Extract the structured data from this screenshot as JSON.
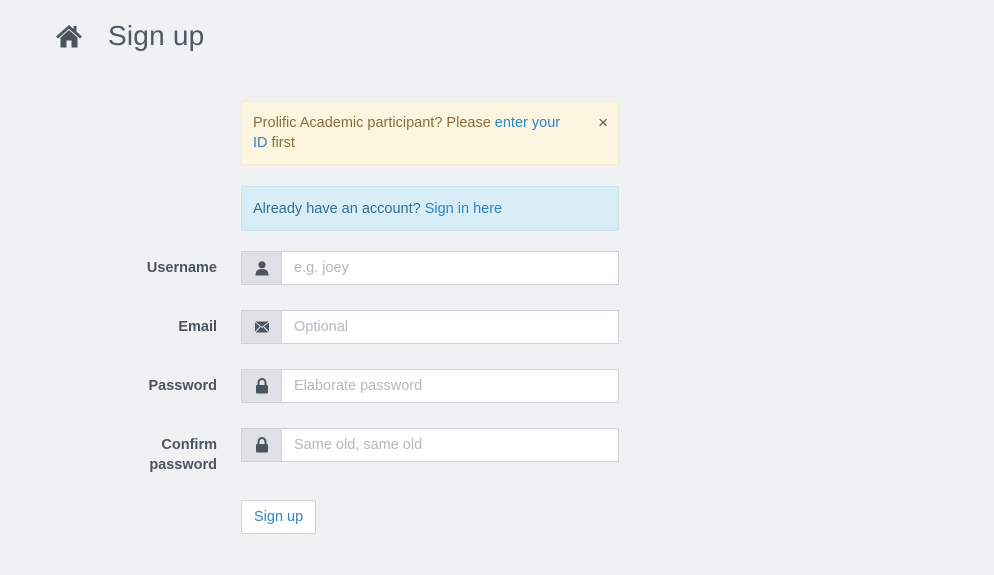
{
  "header": {
    "title": "Sign up",
    "icon": "home-icon"
  },
  "alerts": {
    "prolific": {
      "text_before": "Prolific Academic participant? Please ",
      "link": "enter your ID",
      "text_after": " first",
      "close": "×"
    },
    "account": {
      "text": "Already have an account? ",
      "link": "Sign in here"
    }
  },
  "form": {
    "username": {
      "label": "Username",
      "placeholder": "e.g. joey",
      "value": "",
      "icon": "user-icon"
    },
    "email": {
      "label": "Email",
      "placeholder": "Optional",
      "value": "",
      "icon": "envelope-icon"
    },
    "password": {
      "label": "Password",
      "placeholder": "Elaborate password",
      "value": "",
      "icon": "lock-icon"
    },
    "confirm": {
      "label_line1": "Confirm",
      "label_line2": "password",
      "placeholder": "Same old, same old",
      "value": "",
      "icon": "lock-icon"
    },
    "submit_label": "Sign up"
  },
  "colors": {
    "background": "#f0f1f3",
    "warning_bg": "#fcf6e1",
    "info_bg": "#d9edf7",
    "link": "#2c86c5"
  }
}
